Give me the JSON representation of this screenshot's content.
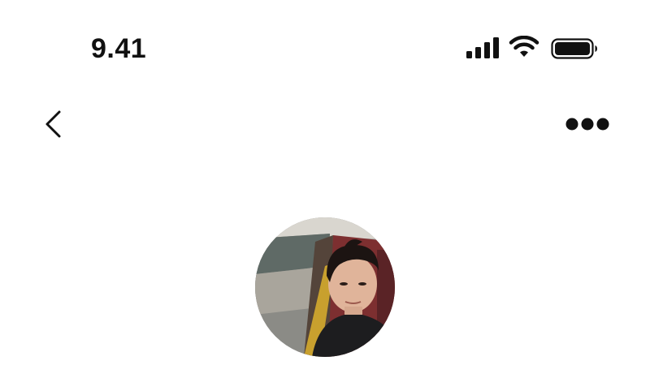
{
  "status_bar": {
    "time": "9.41",
    "signal_icon": "cellular-signal-icon",
    "wifi_icon": "wifi-icon",
    "battery_icon": "battery-full-icon"
  },
  "nav": {
    "back_icon": "chevron-left-icon",
    "more_icon": "ellipsis-horizontal-icon"
  },
  "profile": {
    "avatar_icon": "profile-photo"
  },
  "colors": {
    "background": "#ffffff",
    "text": "#111111",
    "icon": "#111111"
  }
}
